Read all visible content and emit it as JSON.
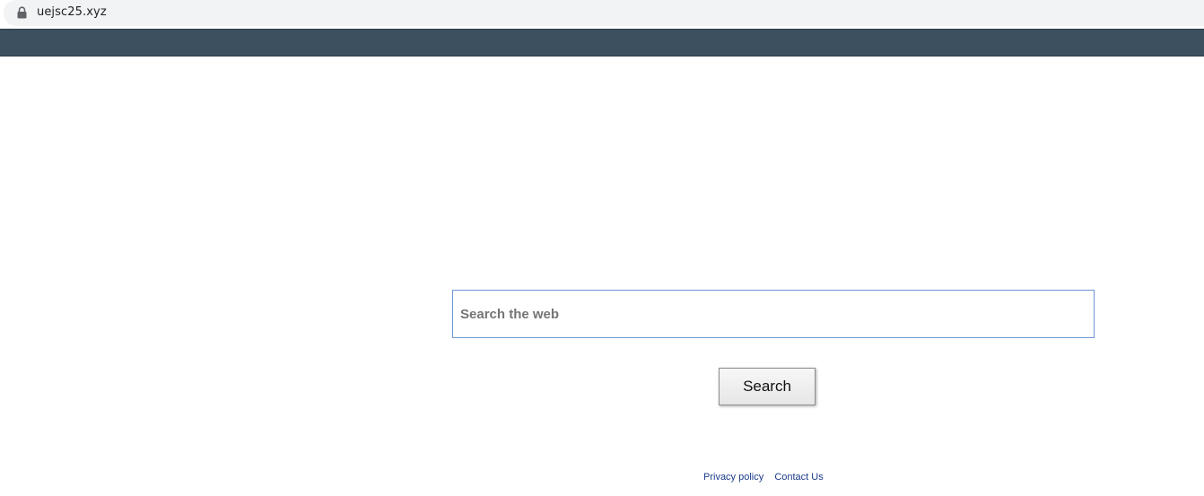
{
  "browser": {
    "url": "uejsc25.xyz",
    "lock_icon": "lock-icon"
  },
  "header": {
    "band_color": "#3d5060"
  },
  "search": {
    "placeholder": "Search the web",
    "value": "",
    "button_label": "Search",
    "input_border_color": "#6f96d8"
  },
  "footer": {
    "links": [
      {
        "label": "Privacy policy"
      },
      {
        "label": "Contact Us"
      }
    ],
    "link_color": "#1a3a8a"
  }
}
